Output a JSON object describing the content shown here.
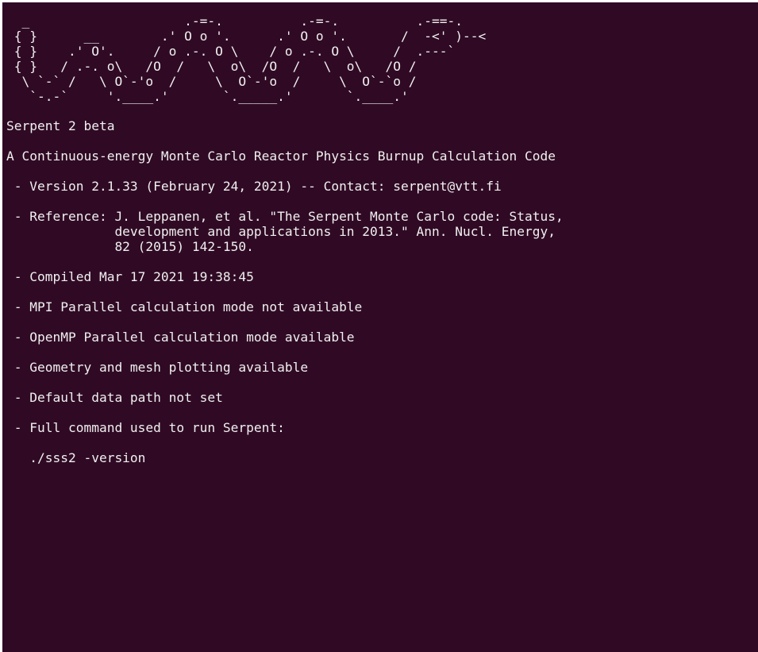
{
  "terminal": {
    "background": "#300a24",
    "foreground": "#f0f0f0",
    "ascii_art": [
      "  _                    .-=-.          .-=-.          .-==-.",
      " { }      __        .' O o '.      .' O o '.       /  -<' )--<",
      " { }    .' O'.     / o .-. O \\    / o .-. O \\     /  .---`",
      " { }   / .-. o\\   /O  /   \\  o\\  /O  /   \\  o\\   /O /",
      "  \\ `-` /   \\ O`-'o  /     \\  O`-'o  /     \\  O`-`o /",
      "   `-.-`     '.____.'       `._____.'       `.____.'"
    ],
    "title": "Serpent 2 beta",
    "subtitle": "A Continuous-energy Monte Carlo Reactor Physics Burnup Calculation Code",
    "version_line": " - Version 2.1.33 (February 24, 2021) -- Contact: serpent@vtt.fi",
    "reference_lines": [
      " - Reference: J. Leppanen, et al. \"The Serpent Monte Carlo code: Status,",
      "              development and applications in 2013.\" Ann. Nucl. Energy,",
      "              82 (2015) 142-150."
    ],
    "compiled_line": " - Compiled Mar 17 2021 19:38:45",
    "mpi_line": " - MPI Parallel calculation mode not available",
    "openmp_line": " - OpenMP Parallel calculation mode available",
    "geometry_line": " - Geometry and mesh plotting available",
    "datapath_line": " - Default data path not set",
    "command_label_line": " - Full command used to run Serpent:",
    "command_line": "   ./sss2 -version"
  }
}
